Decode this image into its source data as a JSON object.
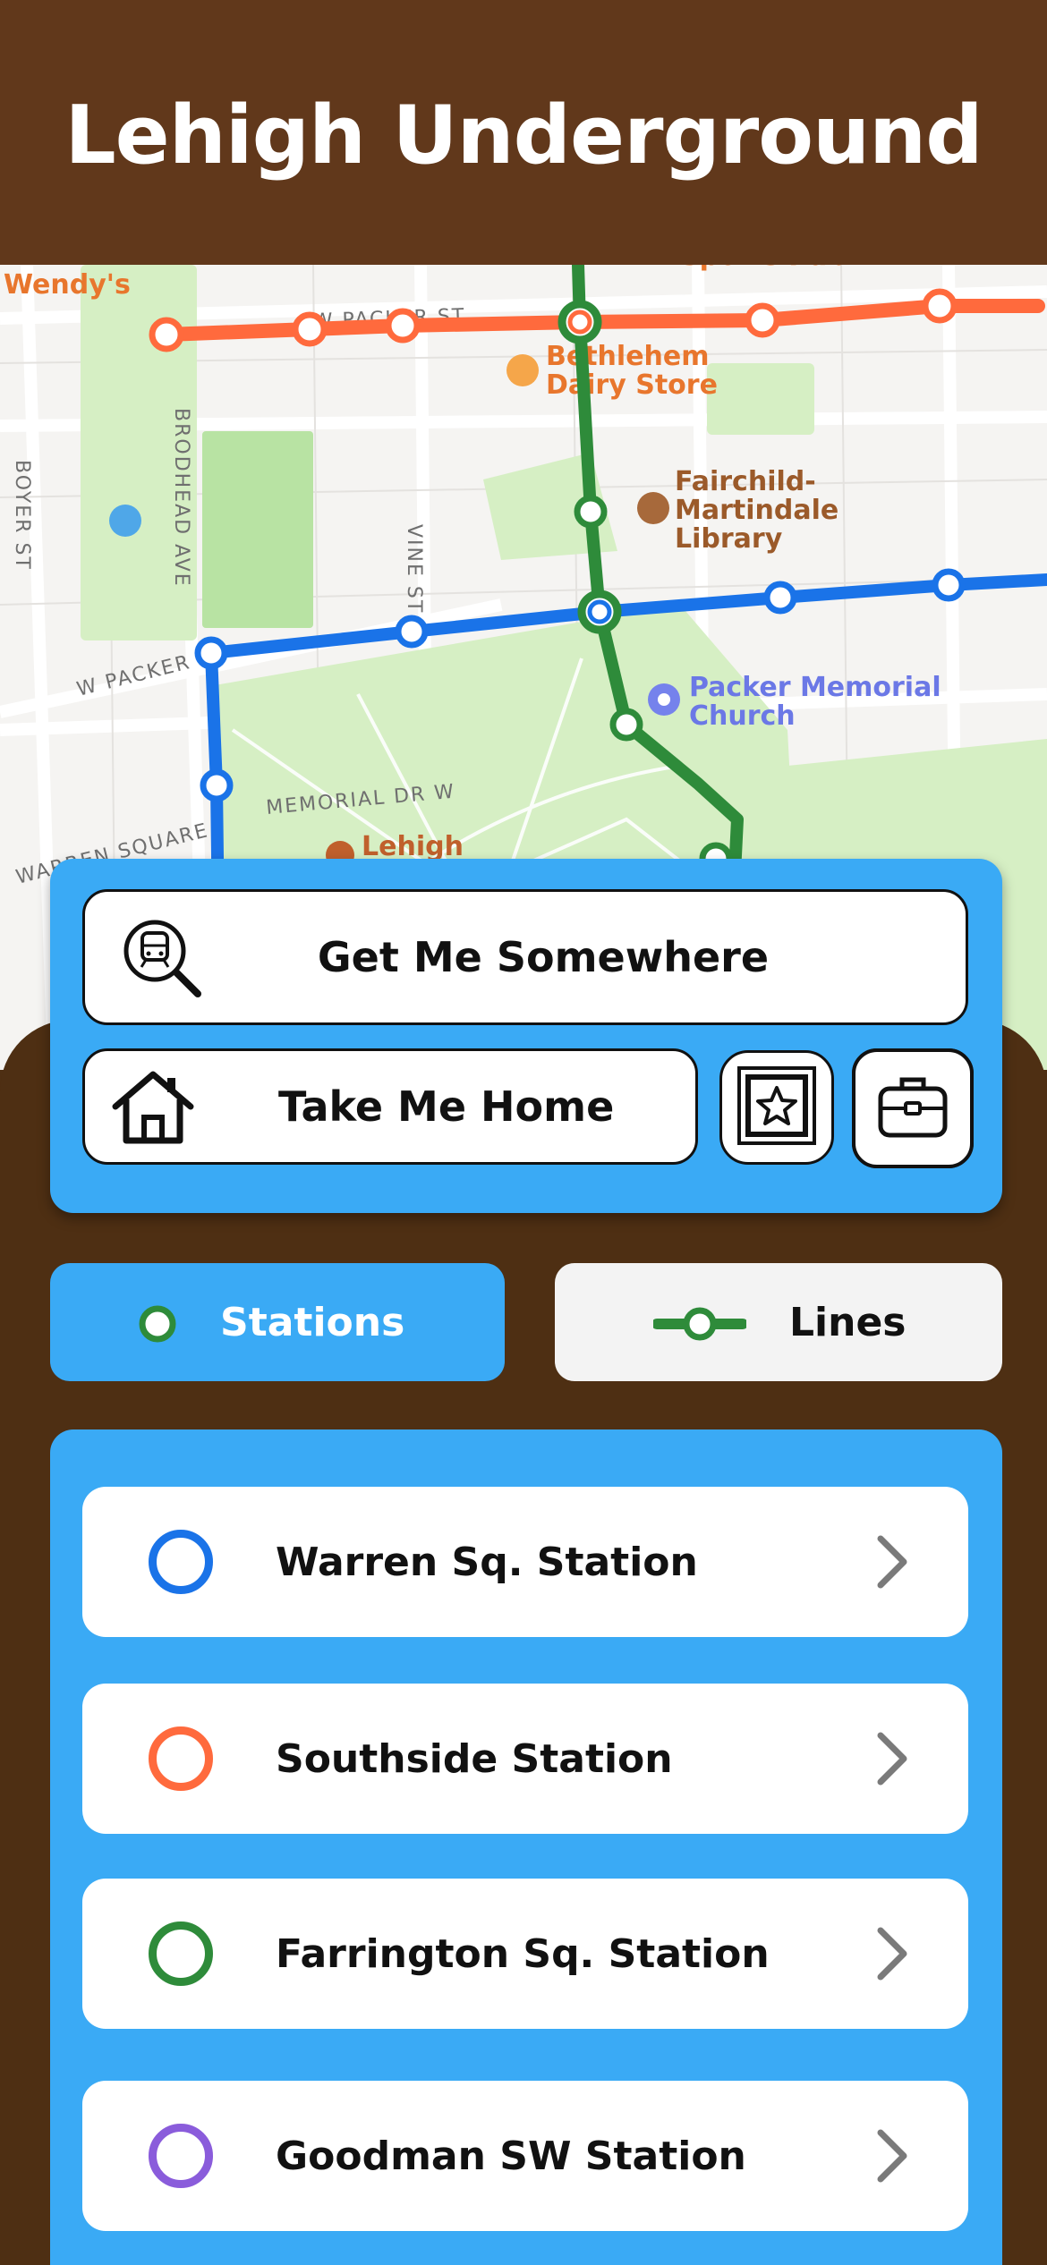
{
  "app": {
    "title": "Lehigh Underground"
  },
  "map": {
    "labels": {
      "wendys": "Wendy's",
      "sports_pub": "Sports Pub",
      "street_wpacker_top": "W PACKER ST",
      "bethlehem_dairy_1": "Bethlehem",
      "bethlehem_dairy_2": "Dairy Store",
      "fairchild_1": "Fairchild-",
      "fairchild_2": "Martindale",
      "fairchild_3": "Library",
      "boyer_st": "BOYER ST",
      "brodhead_ave": "BRODHEAD AVE",
      "vine_st": "VINE ST",
      "w_packer": "W PACKER",
      "packer_church_1": "Packer Memorial",
      "packer_church_2": "Church",
      "memorial_dr": "MEMORIAL DR W",
      "warren_square": "WARREN SQUARE",
      "lehigh": "Lehigh"
    },
    "line_colors": {
      "orange": "#ff6a3d",
      "green": "#2e8b3a",
      "blue": "#1a73e8",
      "purple": "#8a5cdb"
    }
  },
  "actions": {
    "get_me_somewhere": "Get Me Somewhere",
    "take_me_home": "Take Me Home",
    "favorites_icon": "star-icon",
    "work_icon": "briefcase-icon"
  },
  "tabs": {
    "stations": "Stations",
    "lines": "Lines",
    "active": "stations"
  },
  "stations": [
    {
      "name": "Warren Sq. Station",
      "color": "#1a73e8"
    },
    {
      "name": "Southside Station",
      "color": "#ff6a3d"
    },
    {
      "name": "Farrington Sq. Station",
      "color": "#2e8b3a"
    },
    {
      "name": "Goodman SW Station",
      "color": "#8a5cdb"
    }
  ],
  "colors": {
    "header_bg": "#61381b",
    "body_bg": "#4e2f13",
    "accent_blue": "#3aaaf5"
  }
}
